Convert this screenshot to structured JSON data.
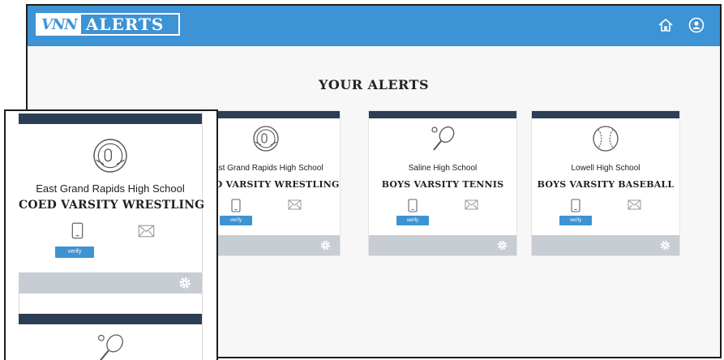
{
  "app": {
    "logo_mark": "VNN",
    "logo_text": "ALERTS",
    "home_icon": "home-icon",
    "user_icon": "user-icon"
  },
  "page": {
    "title": "YOUR ALERTS"
  },
  "alerts": [
    {
      "sport_icon": "wrestling-headgear-icon",
      "school": "East Grand Rapids High School",
      "team": "COED VARSITY WRESTLING",
      "verify_label": "verify"
    },
    {
      "sport_icon": "tennis-racket-icon",
      "school": "Saline High School",
      "team": "BOYS VARSITY TENNIS",
      "verify_label": "verify"
    },
    {
      "sport_icon": "baseball-icon",
      "school": "Lowell High School",
      "team": "BOYS VARSITY BASEBALL",
      "verify_label": "verify"
    }
  ],
  "colors": {
    "brand_blue": "#3d93d4",
    "card_header": "#2c3e55",
    "card_footer": "#c7cdd3"
  }
}
